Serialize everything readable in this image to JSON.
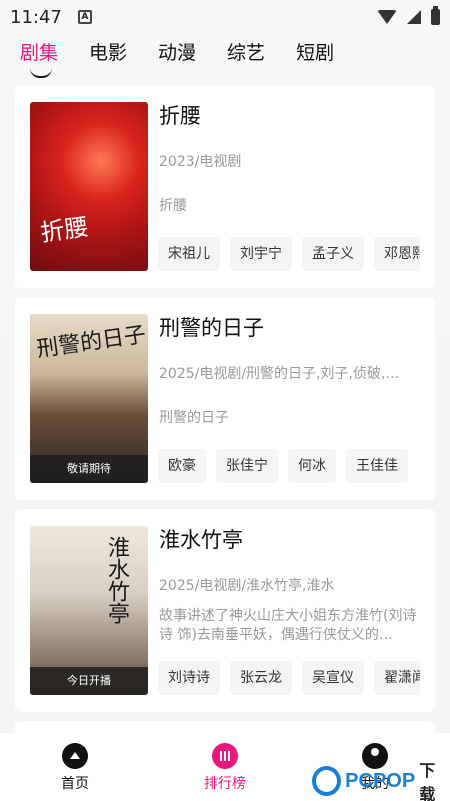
{
  "status_bar": {
    "time": "11:47",
    "notification": "A"
  },
  "tabs": [
    {
      "label": "剧集",
      "active": true
    },
    {
      "label": "电影"
    },
    {
      "label": "动漫"
    },
    {
      "label": "综艺"
    },
    {
      "label": "短剧"
    }
  ],
  "cards": [
    {
      "title": "折腰",
      "meta": "2023/电视剧",
      "desc": "折腰",
      "poster_text": "折腰",
      "tags": [
        "宋祖儿",
        "刘宇宁",
        "孟子义",
        "邓恩熙"
      ]
    },
    {
      "title": "刑警的日子",
      "meta": "2025/电视剧/刑警的日子,刘子,侦破,…",
      "desc": "刑警的日子",
      "poster_text": "刑警的日子",
      "poster_foot": "敬请期待",
      "tags": [
        "欧豪",
        "张佳宁",
        "何冰",
        "王佳佳"
      ]
    },
    {
      "title": "淮水竹亭",
      "meta": "2025/电视剧/淮水竹亭,淮水",
      "desc": "故事讲述了神火山庄大小姐东方淮竹(刘诗诗 饰)去南垂平妖，偶遇行侠仗义的…",
      "poster_text": "淮水竹亭",
      "poster_foot": "今日开播",
      "tags": [
        "刘诗诗",
        "张云龙",
        "吴宣仪",
        "翟潇闻"
      ]
    }
  ],
  "bottom_nav": [
    {
      "label": "首页",
      "icon": "home-icon"
    },
    {
      "label": "排行榜",
      "icon": "rank-icon",
      "active": true
    },
    {
      "label": "我的",
      "icon": "profile-icon"
    }
  ],
  "watermark": {
    "brand": "PCPOP",
    "suffix": "下载"
  },
  "colors": {
    "accent": "#e8197c",
    "watermark": "#1a7fd6"
  }
}
